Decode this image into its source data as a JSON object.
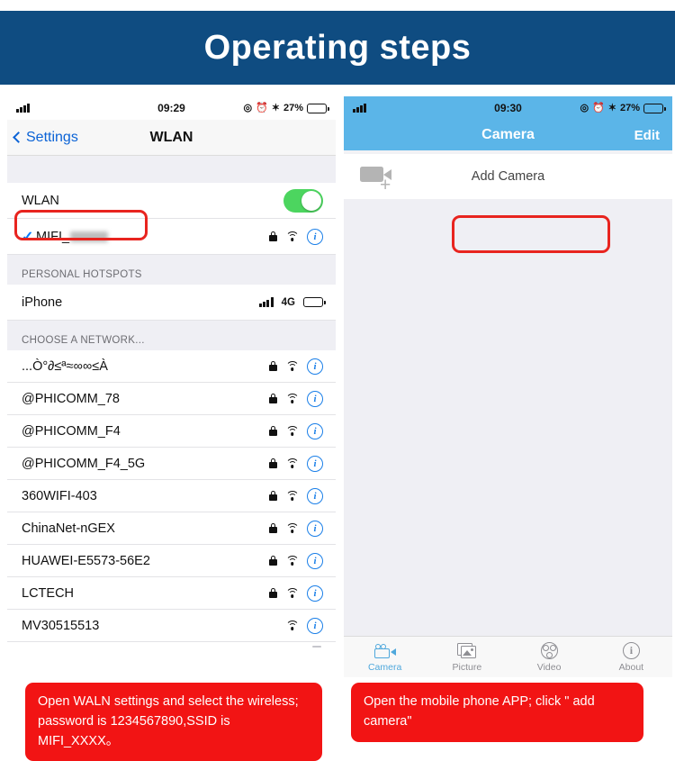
{
  "header": {
    "title": "Operating steps",
    "background": "#0F4C81"
  },
  "left_phone": {
    "statusbar": {
      "time": "09:29",
      "battery_percent": "27%",
      "icons": [
        "location-icon",
        "alarm-icon",
        "bluetooth-icon",
        "battery-icon"
      ]
    },
    "nav": {
      "back_label": "Settings",
      "title": "WLAN"
    },
    "wlan_toggle": {
      "label": "WLAN",
      "state": "on",
      "color": "#4CD55F"
    },
    "connected_network": {
      "name": "MIFI_",
      "redacted": true,
      "checked": true
    },
    "sections": [
      {
        "header": "PERSONAL HOTSPOTS",
        "rows": [
          {
            "label": "iPhone",
            "network": "4G"
          }
        ]
      },
      {
        "header": "CHOOSE A NETWORK...",
        "rows": [
          {
            "label": "...Ò°∂≤ª≈∞∞≤À",
            "locked": true
          },
          {
            "label": "@PHICOMM_78",
            "locked": true
          },
          {
            "label": "@PHICOMM_F4",
            "locked": true
          },
          {
            "label": "@PHICOMM_F4_5G",
            "locked": true
          },
          {
            "label": "360WIFI-403",
            "locked": true
          },
          {
            "label": "ChinaNet-nGEX",
            "locked": true
          },
          {
            "label": "HUAWEI-E5573-56E2",
            "locked": true
          },
          {
            "label": "LCTECH",
            "locked": true
          },
          {
            "label": "MV30515513",
            "locked": false
          }
        ]
      }
    ]
  },
  "right_phone": {
    "statusbar": {
      "time": "09:30",
      "battery_percent": "27%"
    },
    "nav": {
      "title": "Camera",
      "edit_label": "Edit",
      "background": "#5BB5E8"
    },
    "add_camera": {
      "label": "Add Camera"
    },
    "tabs": [
      {
        "label": "Camera",
        "icon": "camcorder-icon",
        "active": true
      },
      {
        "label": "Picture",
        "icon": "picture-icon",
        "active": false
      },
      {
        "label": "Video",
        "icon": "video-icon",
        "active": false
      },
      {
        "label": "About",
        "icon": "info-icon",
        "active": false
      }
    ]
  },
  "captions": {
    "left": "Open WALN settings and select the wireless; password is 1234567890,SSID is MIFI_XXXX。",
    "right": "Open the mobile phone APP; click \" add camera\"",
    "color": "#F21414"
  }
}
